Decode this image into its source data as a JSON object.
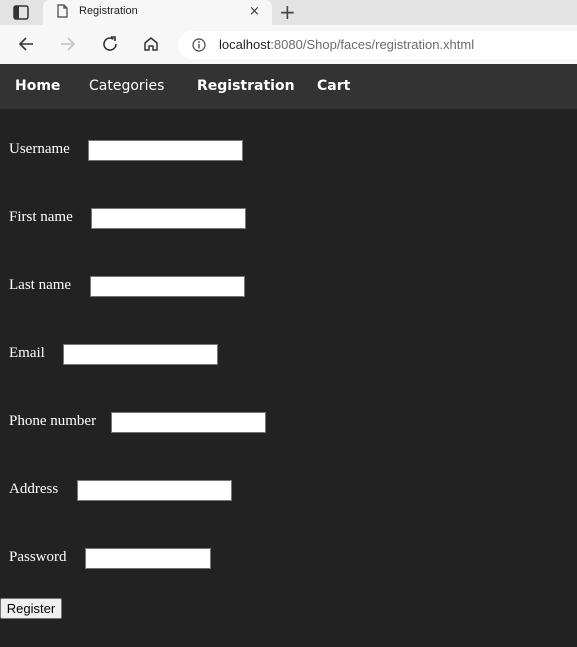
{
  "browser": {
    "tab_title": "Registration",
    "tab_close_glyph": "×",
    "new_tab_glyph": "+",
    "url_host": "localhost",
    "url_rest": ":8080/Shop/faces/registration.xhtml"
  },
  "nav": {
    "items": [
      {
        "label": "Home",
        "bold": true
      },
      {
        "label": "Categories",
        "bold": false
      },
      {
        "label": "Registration",
        "bold": true
      },
      {
        "label": "Cart",
        "bold": true
      }
    ]
  },
  "form": {
    "fields": [
      {
        "label": "Username",
        "value": ""
      },
      {
        "label": "First name",
        "value": ""
      },
      {
        "label": "Last name",
        "value": ""
      },
      {
        "label": "Email",
        "value": ""
      },
      {
        "label": "Phone number",
        "value": ""
      },
      {
        "label": "Address",
        "value": ""
      },
      {
        "label": "Password",
        "value": ""
      }
    ],
    "submit_label": "Register"
  },
  "colors": {
    "page_background": "#222222",
    "nav_background": "#333333",
    "text": "#ffffff"
  }
}
